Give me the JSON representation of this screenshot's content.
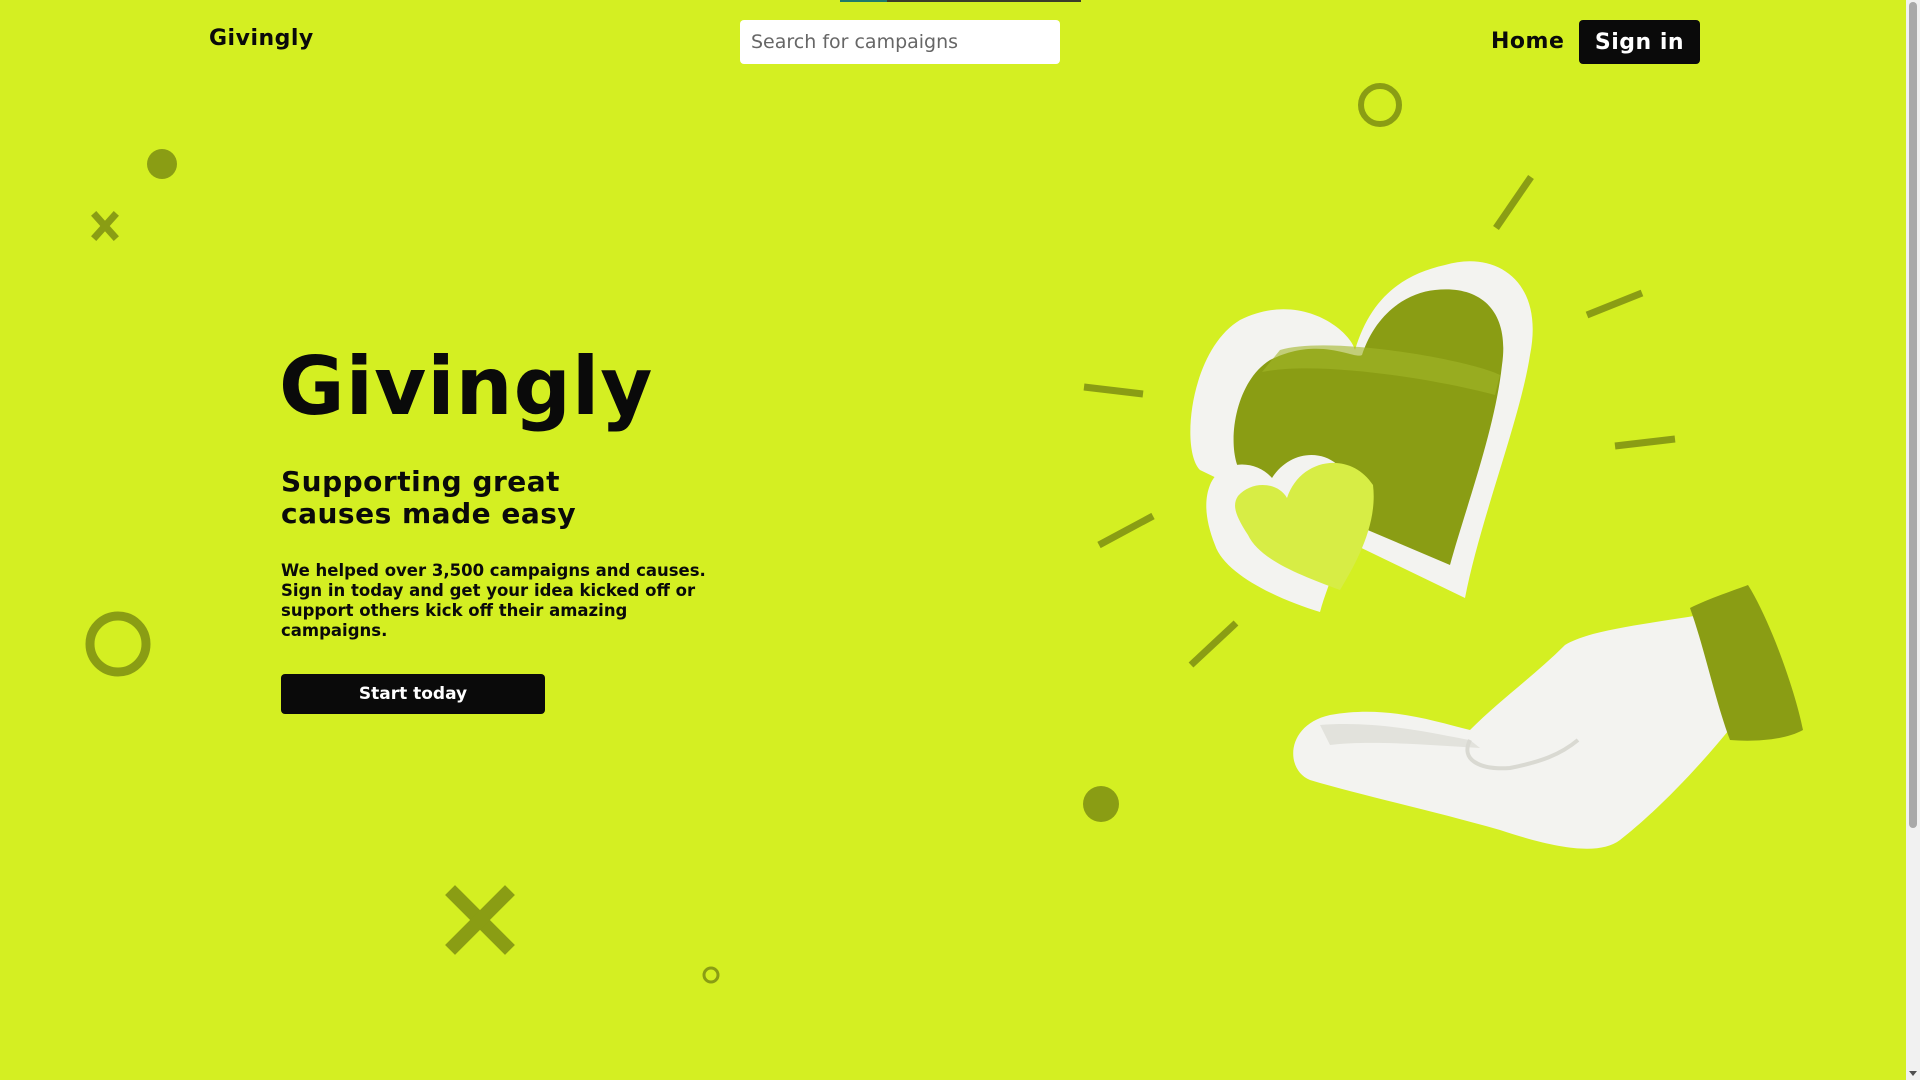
{
  "header": {
    "logo": "Givingly",
    "search_placeholder": "Search for campaigns",
    "nav_home": "Home",
    "sign_in": "Sign in"
  },
  "hero": {
    "title": "Givingly",
    "subtitle": "Supporting great causes made easy",
    "description": "We helped over 3,500 campaigns and causes. Sign in today and get your idea kicked off or support others kick off their amazing campaigns.",
    "cta": "Start today"
  },
  "illustration": {
    "subject": "hand holding hearts"
  },
  "colors": {
    "background": "#d4ef22",
    "accent_dark": "#8a9d14",
    "text": "#0a0a0a",
    "button": "#0a0a0a",
    "button_text": "#ffffff"
  }
}
